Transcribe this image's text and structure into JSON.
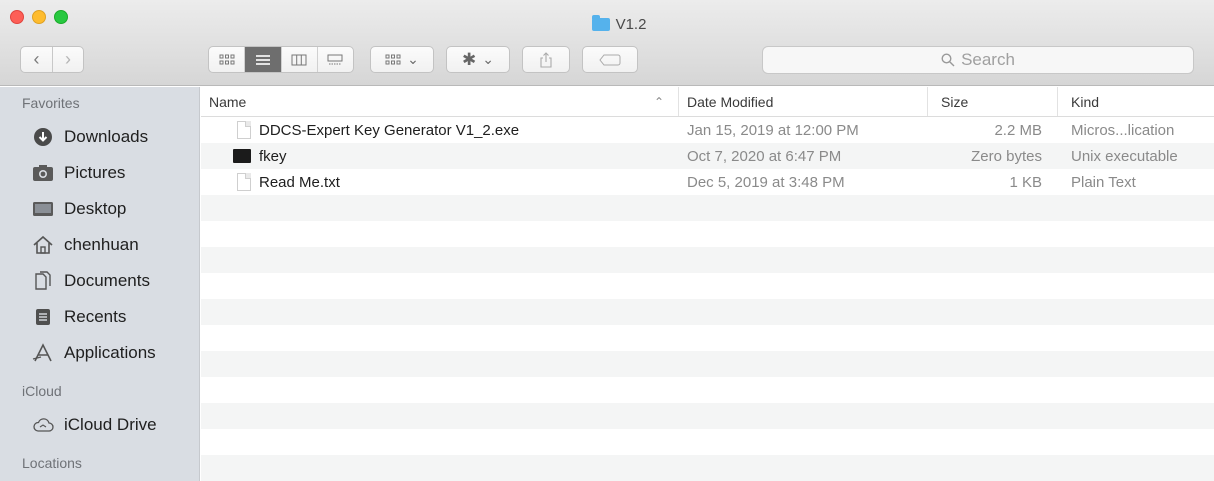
{
  "window": {
    "title": "V1.2"
  },
  "toolbar": {
    "back_glyph": "‹",
    "forward_glyph": "›",
    "search_placeholder": "Search",
    "arrange_chevron": "⌄",
    "action_chevron": "⌄"
  },
  "sidebar": {
    "favorites_label": "Favorites",
    "favorites": [
      {
        "label": "Downloads",
        "icon": "downloads-icon"
      },
      {
        "label": "Pictures",
        "icon": "pictures-icon"
      },
      {
        "label": "Desktop",
        "icon": "desktop-icon"
      },
      {
        "label": "chenhuan",
        "icon": "home-icon"
      },
      {
        "label": "Documents",
        "icon": "documents-icon"
      },
      {
        "label": "Recents",
        "icon": "recents-icon"
      },
      {
        "label": "Applications",
        "icon": "applications-icon"
      }
    ],
    "icloud_label": "iCloud",
    "icloud": [
      {
        "label": "iCloud Drive",
        "icon": "icloud-drive-icon"
      }
    ],
    "locations_label": "Locations"
  },
  "columns": {
    "name": "Name",
    "date": "Date Modified",
    "size": "Size",
    "kind": "Kind"
  },
  "files": [
    {
      "name": "DDCS-Expert Key Generator V1_2.exe",
      "date": "Jan 15, 2019 at 12:00 PM",
      "size": "2.2 MB",
      "kind": "Micros...lication",
      "icon": "document-icon"
    },
    {
      "name": "fkey",
      "date": "Oct 7, 2020 at 6:47 PM",
      "size": "Zero bytes",
      "kind": "Unix executable",
      "icon": "terminal-executable-icon"
    },
    {
      "name": "Read Me.txt",
      "date": "Dec 5, 2019 at 3:48 PM",
      "size": "1 KB",
      "kind": "Plain Text",
      "icon": "text-file-icon"
    }
  ]
}
